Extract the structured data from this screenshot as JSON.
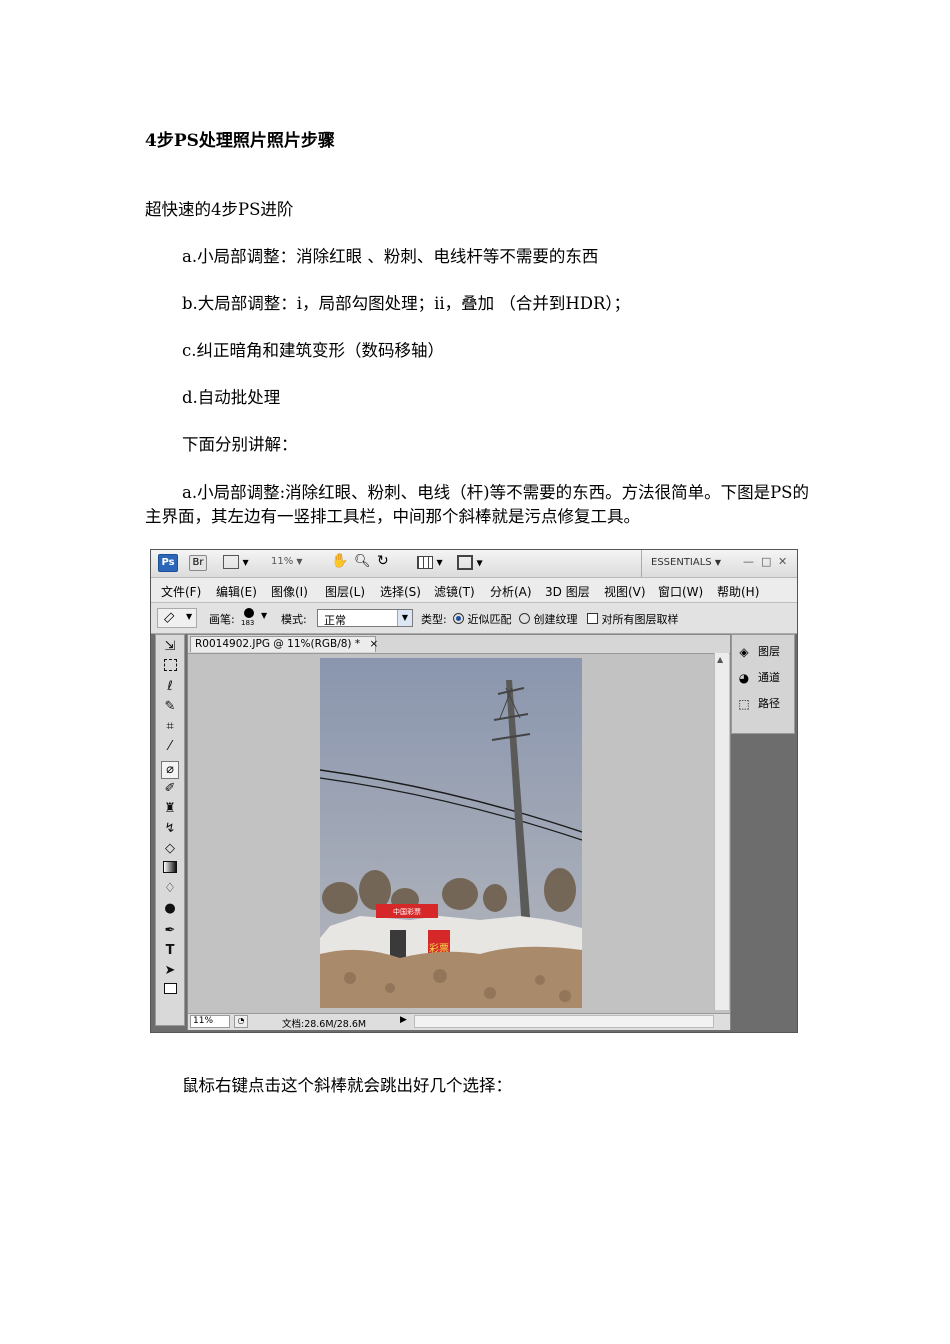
{
  "heading": "4步PS处理照片照片步骤",
  "intro": "超快速的4步PS进阶",
  "steps": [
    "a.小局部调整：消除红眼 、粉刺、电线杆等不需要的东西",
    "b.大局部调整：i，局部勾图处理；ii，叠加 （合并到HDR）；",
    "c.纠正暗角和建筑变形（数码移轴）",
    "d.自动批处理"
  ],
  "explain_intro": "下面分别讲解：",
  "explain_a": "a.小局部调整:消除红眼、粉刺、电线（杆)等不需要的东西。方法很简单。下图是PS的主界面，其左边有一竖排工具栏，中间那个斜棒就是污点修复工具。",
  "closing": "鼠标右键点击这个斜棒就会跳出好几个选择：",
  "ps": {
    "logo": "Ps",
    "bridge": "Br",
    "zoom_top": "11%",
    "workspace": "ESSENTIALS",
    "window_controls": [
      "—",
      "□",
      "✕"
    ],
    "menu": [
      "文件(F)",
      "编辑(E)",
      "图像(I)",
      "图层(L)",
      "选择(S)",
      "滤镜(T)",
      "分析(A)",
      "3D 图层",
      "视图(V)",
      "窗口(W)",
      "帮助(H)"
    ],
    "options": {
      "brush_label": "画笔:",
      "brush_size": "183",
      "mode_label": "模式:",
      "mode_value": "正常",
      "type_label": "类型:",
      "radio1": "近似匹配",
      "radio2": "创建纹理",
      "checkbox": "对所有图层取样"
    },
    "doc_tab": "R0014902.JPG @ 11%(RGB/8) *",
    "tab_close": "×",
    "status_zoom": "11%",
    "status_doc": "文档:28.6M/28.6M",
    "panels": [
      "图层",
      "通道",
      "路径"
    ],
    "photo_sign": "彩票",
    "photo_banner": "中国彩票"
  },
  "colors": {
    "sky_top": "#8a96ae",
    "sky_bottom": "#b5b7bd",
    "ground": "#a98b6b",
    "ps_logo": "#2b66b8",
    "banner_red": "#d62828"
  }
}
